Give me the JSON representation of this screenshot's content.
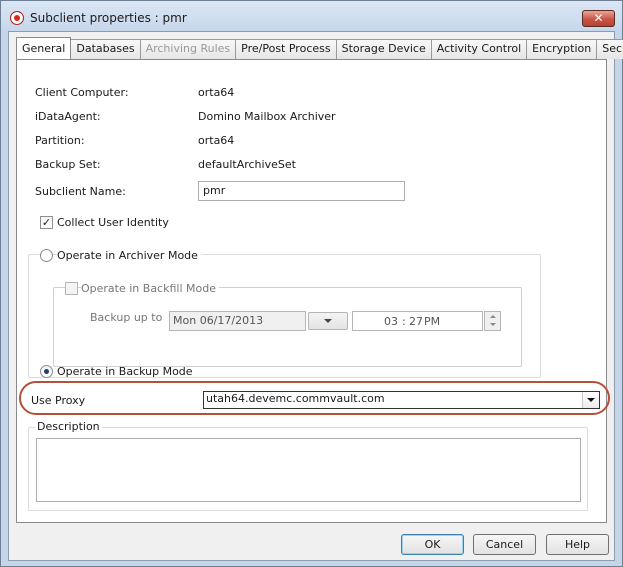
{
  "window": {
    "title": "Subclient properties : pmr",
    "close_glyph": "✕"
  },
  "tabs": [
    {
      "label": "General",
      "state": "active"
    },
    {
      "label": "Databases",
      "state": "normal"
    },
    {
      "label": "Archiving Rules",
      "state": "disabled"
    },
    {
      "label": "Pre/Post Process",
      "state": "normal"
    },
    {
      "label": "Storage Device",
      "state": "normal"
    },
    {
      "label": "Activity Control",
      "state": "normal"
    },
    {
      "label": "Encryption",
      "state": "normal"
    },
    {
      "label": "Security",
      "state": "normal"
    }
  ],
  "general": {
    "client_computer": {
      "label": "Client Computer:",
      "value": "orta64"
    },
    "idataagent": {
      "label": "iDataAgent:",
      "value": "Domino Mailbox Archiver"
    },
    "partition": {
      "label": "Partition:",
      "value": "orta64"
    },
    "backup_set": {
      "label": "Backup Set:",
      "value": "defaultArchiveSet"
    },
    "subclient_name": {
      "label": "Subclient Name:",
      "value": "pmr"
    },
    "collect_user_identity": {
      "label": "Collect User Identity",
      "checked": true
    },
    "archiver_mode": {
      "label": "Operate in Archiver Mode",
      "selected": false
    },
    "backfill_mode": {
      "label": "Operate in Backfill Mode",
      "checked": false,
      "enabled": false
    },
    "backup_up_to": {
      "label": "Backup up to",
      "date": "Mon 06/17/2013",
      "time_hour": "03",
      "time_sep": ":",
      "time_minute": "27",
      "time_ampm": "PM"
    },
    "backup_mode": {
      "label": "Operate in Backup Mode",
      "selected": true
    },
    "use_proxy": {
      "label": "Use Proxy",
      "value": "utah64.devemc.commvault.com"
    },
    "description": {
      "label": "Description",
      "value": ""
    }
  },
  "buttons": {
    "ok": "OK",
    "cancel": "Cancel",
    "help": "Help"
  },
  "colors": {
    "highlight_oval": "#b5503a",
    "title_bar": "#c6d7ec",
    "selected_radio": "#1f3f6e"
  }
}
